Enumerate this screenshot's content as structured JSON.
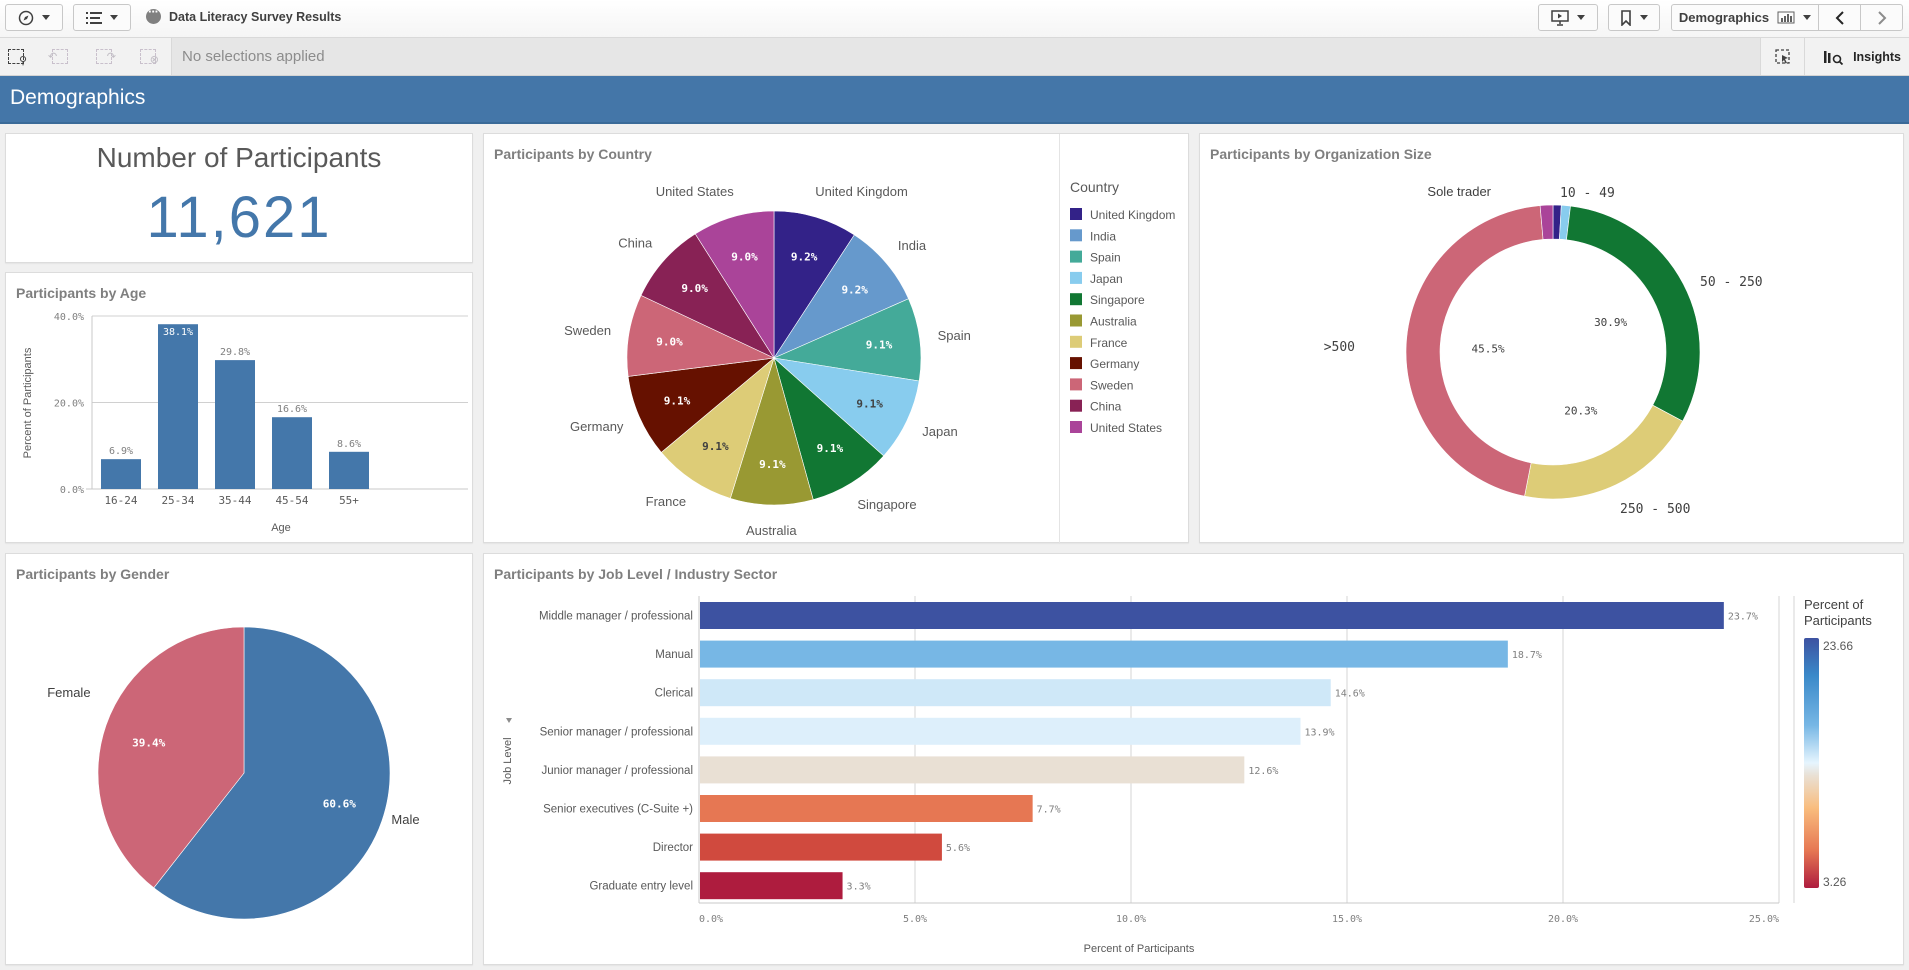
{
  "topbar": {
    "app_title": "Data Literacy Survey Results",
    "sheet_selector_label": "Demographics",
    "icons": [
      "compass-icon",
      "list-icon",
      "presentation-icon",
      "bookmark-icon",
      "sheet-chart-icon",
      "chevron-left-icon",
      "chevron-right-icon"
    ]
  },
  "selections": {
    "status_text": "No selections applied",
    "insights_label": "Insights",
    "tools": [
      "smart-search",
      "step-back",
      "step-forward",
      "clear-all"
    ]
  },
  "sheet": {
    "title": "Demographics"
  },
  "kpi": {
    "label": "Number of Participants",
    "value": "11,621"
  },
  "age_chart": {
    "title": "Participants by Age",
    "color": "#4477aa"
  },
  "country_chart": {
    "title": "Participants by Country",
    "legend_title": "Country"
  },
  "org_chart": {
    "title": "Participants by Organization Size"
  },
  "gender_chart": {
    "title": "Participants by Gender"
  },
  "job_chart": {
    "title": "Participants by Job Level / Industry Sector",
    "y_dim_label": "Job Level",
    "legend_title_line1": "Percent of",
    "legend_title_line2": "Participants",
    "legend_max": "23.66",
    "legend_min": "3.26"
  },
  "chart_data": [
    {
      "id": "age",
      "type": "bar",
      "title": "Participants by Age",
      "categories": [
        "16-24",
        "25-34",
        "35-44",
        "45-54",
        "55+"
      ],
      "values": [
        6.9,
        38.1,
        29.8,
        16.6,
        8.6
      ],
      "labels": [
        "6.9%",
        "38.1%",
        "29.8%",
        "16.6%",
        "8.6%"
      ],
      "xlabel": "Age",
      "ylabel": "Percent of Participants",
      "ylim": [
        0,
        40
      ],
      "yticks": [
        "0.0%",
        "20.0%",
        "40.0%"
      ],
      "grid": true
    },
    {
      "id": "country",
      "type": "pie",
      "title": "Participants by Country",
      "legend_position": "right",
      "slices": [
        {
          "label": "United Kingdom",
          "value": 9.2,
          "text": "9.2%",
          "color": "#332288",
          "textColor": "#ffffff"
        },
        {
          "label": "India",
          "value": 9.2,
          "text": "9.2%",
          "color": "#6699cc",
          "textColor": "#ffffff"
        },
        {
          "label": "Spain",
          "value": 9.1,
          "text": "9.1%",
          "color": "#44aa99",
          "textColor": "#ffffff"
        },
        {
          "label": "Japan",
          "value": 9.1,
          "text": "9.1%",
          "color": "#88ccee",
          "textColor": "#404040"
        },
        {
          "label": "Singapore",
          "value": 9.1,
          "text": "9.1%",
          "color": "#117733",
          "textColor": "#ffffff"
        },
        {
          "label": "Australia",
          "value": 9.1,
          "text": "9.1%",
          "color": "#999933",
          "textColor": "#ffffff"
        },
        {
          "label": "France",
          "value": 9.1,
          "text": "9.1%",
          "color": "#ddcc77",
          "textColor": "#404040"
        },
        {
          "label": "Germany",
          "value": 9.1,
          "text": "9.1%",
          "color": "#661100",
          "textColor": "#ffffff"
        },
        {
          "label": "Sweden",
          "value": 9.0,
          "text": "9.0%",
          "color": "#cc6677",
          "textColor": "#ffffff"
        },
        {
          "label": "China",
          "value": 9.0,
          "text": "9.0%",
          "color": "#882255",
          "textColor": "#ffffff"
        },
        {
          "label": "United States",
          "value": 9.0,
          "text": "9.0%",
          "color": "#aa4499",
          "textColor": "#ffffff"
        }
      ]
    },
    {
      "id": "org_size",
      "type": "pie",
      "donut": true,
      "title": "Participants by Organization Size",
      "slices": [
        {
          "label": "",
          "value": 0.9,
          "text": "",
          "color": "#332288"
        },
        {
          "label": "10 - 49",
          "value": 1.0,
          "text": "",
          "color": "#88ccee"
        },
        {
          "label": "50 - 250",
          "value": 30.9,
          "text": "30.9%",
          "color": "#117733"
        },
        {
          "label": "250 - 500",
          "value": 20.3,
          "text": "20.3%",
          "color": "#ddcc77"
        },
        {
          "label": ">500",
          "value": 45.5,
          "text": "45.5%",
          "color": "#cc6677"
        },
        {
          "label": "Sole trader",
          "value": 1.4,
          "text": "",
          "color": "#aa4499"
        }
      ]
    },
    {
      "id": "gender",
      "type": "pie",
      "title": "Participants by Gender",
      "slices": [
        {
          "label": "Male",
          "value": 60.6,
          "text": "60.6%",
          "color": "#4477aa"
        },
        {
          "label": "Female",
          "value": 39.4,
          "text": "39.4%",
          "color": "#cc6677"
        }
      ]
    },
    {
      "id": "job_level",
      "type": "bar",
      "orientation": "horizontal",
      "title": "Participants by Job Level / Industry Sector",
      "categories": [
        "Middle manager / professional",
        "Manual",
        "Clerical",
        "Senior manager / professional",
        "Junior manager / professional",
        "Senior executives (C-Suite +)",
        "Director",
        "Graduate entry level"
      ],
      "values": [
        23.7,
        18.7,
        14.6,
        13.9,
        12.6,
        7.7,
        5.6,
        3.3
      ],
      "labels": [
        "23.7%",
        "18.7%",
        "14.6%",
        "13.9%",
        "12.6%",
        "7.7%",
        "5.6%",
        "3.3%"
      ],
      "colors": [
        "#3d52a1",
        "#77b7e5",
        "#cfe8f8",
        "#ddeffb",
        "#e9e0d4",
        "#e67753",
        "#d04a3e",
        "#ae1c3e"
      ],
      "xlabel": "Percent of Participants",
      "ylabel": "Job Level",
      "xlim": [
        0,
        25
      ],
      "xticks": [
        "0.0%",
        "5.0%",
        "10.0%",
        "15.0%",
        "20.0%",
        "25.0%"
      ],
      "legend": {
        "type": "gradient",
        "title": "Percent of Participants",
        "max": 23.66,
        "min": 3.26,
        "position": "right"
      },
      "grid": true
    }
  ]
}
